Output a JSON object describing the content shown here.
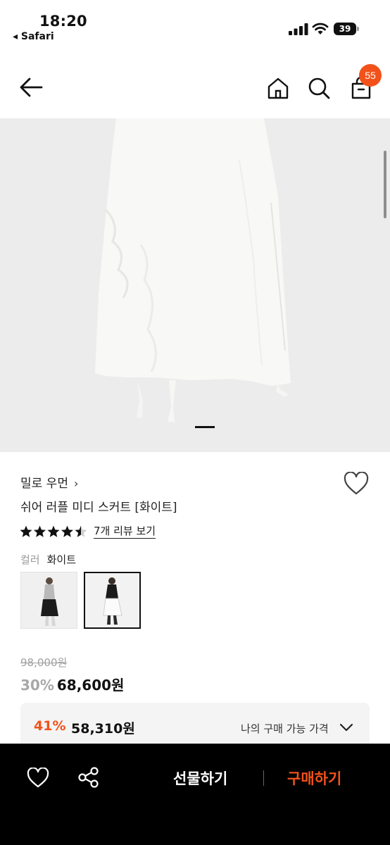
{
  "status_bar": {
    "time": "18:20",
    "back_app": "Safari",
    "battery": "39"
  },
  "nav": {
    "cart_count": "55"
  },
  "product": {
    "brand": "밀로 우먼",
    "brand_chevron": "›",
    "name": "쉬어 러플 미디 스커트 [화이트]",
    "rating": 4.5,
    "review_link": "7개 리뷰 보기",
    "color_label": "컬러",
    "color_value": "화이트"
  },
  "pricing": {
    "original_price": "98,000원",
    "discount_percent": "30%",
    "sale_price": "68,600원",
    "my_price_percent": "41%",
    "my_price": "58,310원",
    "my_price_label": "나의 구매 가능 가격"
  },
  "bottom_bar": {
    "gift_label": "선물하기",
    "buy_label": "구매하기"
  },
  "colors": {
    "accent": "#f2521a",
    "bottom_bar_bg": "#000000"
  }
}
